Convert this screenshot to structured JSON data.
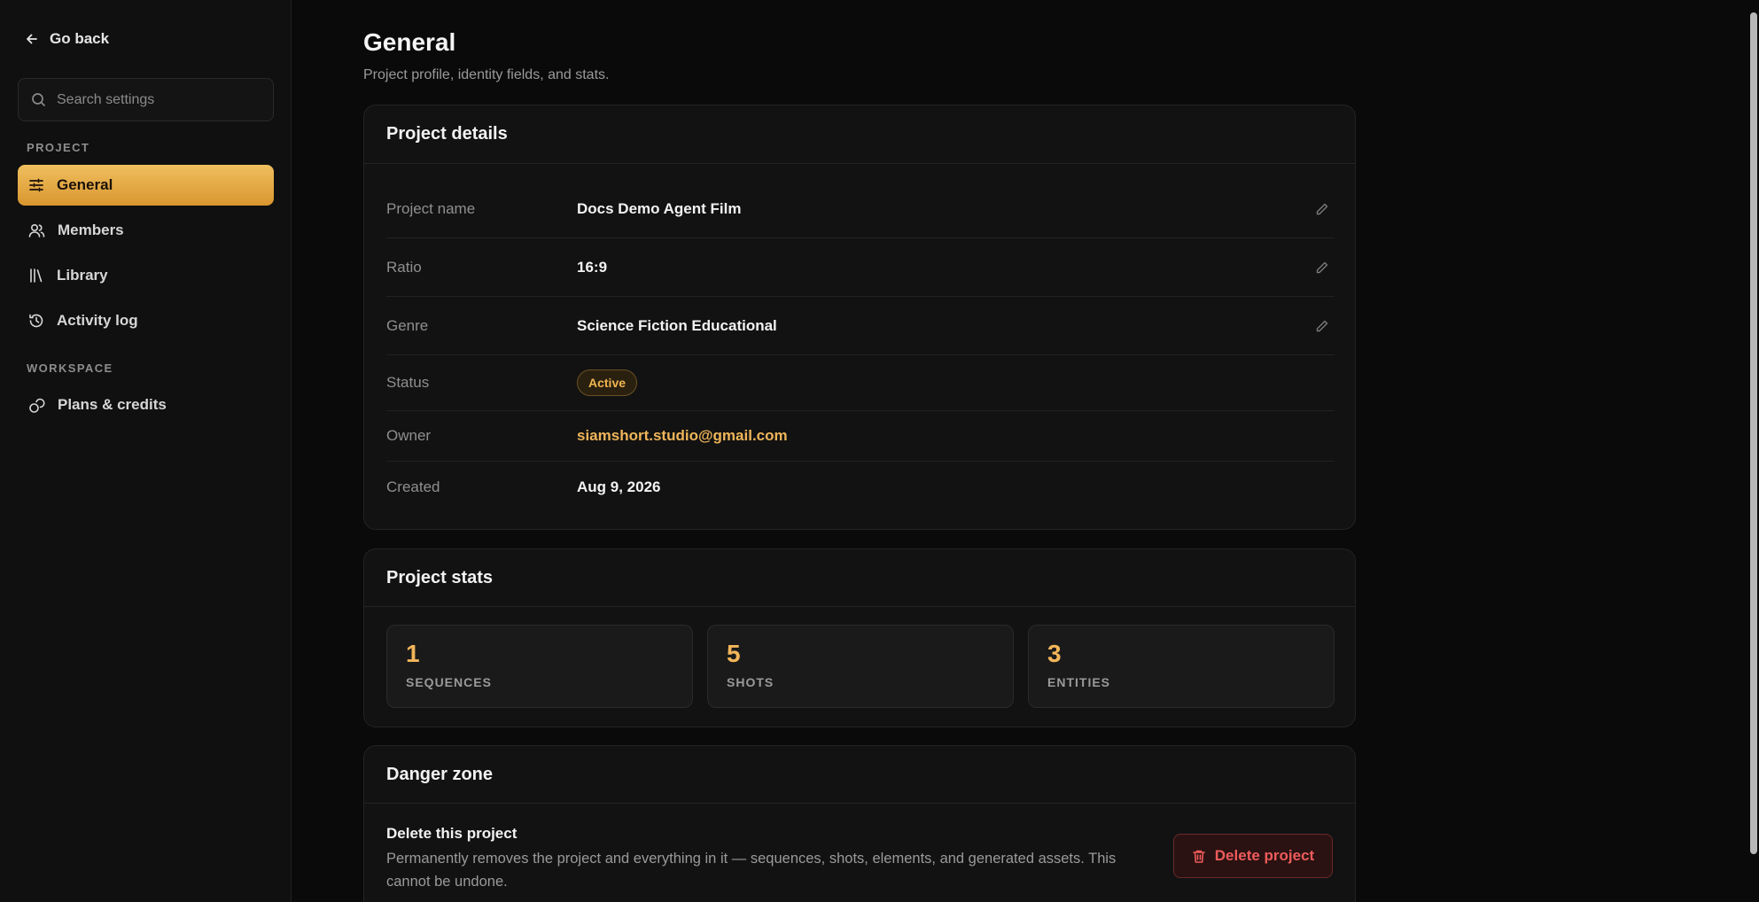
{
  "sidebar": {
    "go_back_label": "Go back",
    "search_placeholder": "Search settings",
    "sections": [
      {
        "label": "PROJECT"
      },
      {
        "label": "WORKSPACE"
      }
    ],
    "items": [
      {
        "label": "General",
        "icon": "sliders-icon",
        "active": true
      },
      {
        "label": "Members",
        "icon": "users-icon"
      },
      {
        "label": "Library",
        "icon": "library-icon"
      },
      {
        "label": "Activity log",
        "icon": "history-icon"
      },
      {
        "label": "Plans & credits",
        "icon": "coins-icon"
      }
    ]
  },
  "page": {
    "title": "General",
    "subtitle": "Project profile, identity fields, and stats."
  },
  "details": {
    "header": "Project details",
    "rows": [
      {
        "label": "Project name",
        "value": "Docs Demo Agent Film",
        "editable": true
      },
      {
        "label": "Ratio",
        "value": "16:9",
        "editable": true
      },
      {
        "label": "Genre",
        "value": "Science Fiction Educational",
        "editable": true
      },
      {
        "label": "Status",
        "value": "Active"
      },
      {
        "label": "Owner",
        "value": "siamshort.studio@gmail.com"
      },
      {
        "label": "Created",
        "value": "Aug 9, 2026"
      }
    ]
  },
  "stats": {
    "header": "Project stats",
    "items": [
      {
        "value": "1",
        "label": "SEQUENCES"
      },
      {
        "value": "5",
        "label": "SHOTS"
      },
      {
        "value": "3",
        "label": "ENTITIES"
      }
    ]
  },
  "danger": {
    "header": "Danger zone",
    "title": "Delete this project",
    "description": "Permanently removes the project and everything in it — sequences, shots, elements, and generated assets. This cannot be undone.",
    "button_label": "Delete project"
  },
  "colors": {
    "accent": "#efb55a",
    "danger": "#ef5b5b",
    "background": "#0a0a0a"
  }
}
